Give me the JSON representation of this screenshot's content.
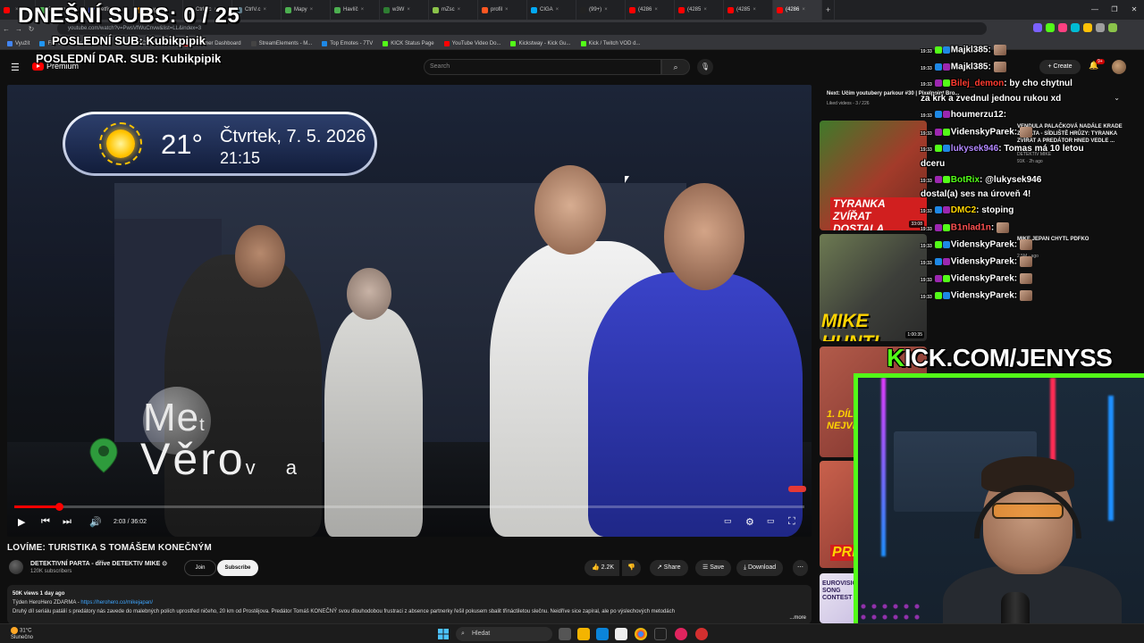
{
  "browser": {
    "tabs": [
      "",
      "2sekun",
      "Betfin",
      "网络",
      "CtrlV.c",
      "CtrlV.c",
      "Mapy",
      "Havlíč",
      "w3W",
      "mZsc",
      "profil",
      "CIGA",
      "(99+)",
      "(4286",
      "(4285",
      "(4285",
      "(4286"
    ],
    "url": "youtube.com/watch?v=PwsVfWuCnvw&list=LL&index=3",
    "bookmarks": [
      "Využít",
      "File Converter - Free...",
      "The best ChatBot an...",
      "Streamer Dashboard",
      "StreamElements - M...",
      "Top Emotes - 7TV",
      "KICK Status Page",
      "YouTube Video Do...",
      "Kickstway - Kick Gu...",
      "Kick / Twitch VOD d..."
    ]
  },
  "youtube": {
    "logo_text": "Premium",
    "search_placeholder": "Search",
    "search_icon": "search-icon",
    "mic_icon": "mic-icon",
    "create_label": "+ Create",
    "notif_count": "9+",
    "video": {
      "weather_temp": "21°",
      "weather_date": "Čtvrtek, 7. 5. 2026",
      "weather_time": "21:15",
      "loc_line1": "Me",
      "loc_line1_small": "t",
      "loc_line2": "Věro",
      "loc_line2_tail": "v a",
      "timecode": "2:03 / 36:02",
      "progress_fraction": 0.057
    },
    "title": "LOVÍME: TURISTIKA S TOMÁŠEM KONEČNÝM",
    "channel": {
      "name": "DETEKTIVNÍ PARTA - dříve DETEKTIV MIKE ⊙",
      "subscribers": "120K subscribers",
      "join_label": "Join",
      "subscribe_label": "Subscribe"
    },
    "actions": {
      "likes": "👍 2.2K",
      "dislike": "👎",
      "share": "↗ Share",
      "save": "☰ Save",
      "download": "⤓ Download",
      "more": "⋯"
    },
    "description": {
      "meta": "50K views  1 day ago",
      "line1_prefix": "Týden HeroHero ZDARMA - ",
      "line1_link": "https://herohero.co/mikejapan/",
      "line2": "Druhý díl seriálu patálií s predátory nás zavede do malebných polích uprostřed ničeho, 20 km od Prostějova. Predátor Tomáš KONEČNÝ svou dlouhodobou frustraci z absence partnerky řešil pokusem sbalit třináctiletou slečnu. Neidříve sice zapíral, ale po výslechových metodách",
      "more": "...more"
    },
    "up_next": {
      "title": "Next: Učím youtubery parkour #30 | Pixelpoint Bro...",
      "subtitle": "Liked videos - 3 / 226"
    },
    "recommendations": [
      {
        "thumb_text": "TYRANKA ZVÍŘAT DOSTALA ZÁSAH!",
        "duration": "33:08",
        "title": "VENDULA PALAČKOVÁ NADÁLE KRADE ZVÍŘATA - SÍDLIŠTĚ HRŮZY: TYRANKA ZVÍŘAT A PREDÁTOR HNED VEDLE ...",
        "channel": "DETEKTIV MIKE",
        "meta": "91K · 2h ago"
      },
      {
        "thumb_text": "MIKE HUNTI PDFKA",
        "duration": "1:00:35",
        "title": "MIKE JEPAN CHYTL PDFKO",
        "channel": "",
        "meta": "2.5M · ago"
      },
      {
        "thumb_text": "1. DÍL NEJVĚ",
        "duration": "",
        "title": "",
        "channel": "",
        "meta": ""
      },
      {
        "thumb_text": "PRE",
        "duration": "",
        "title": "",
        "channel": "",
        "meta": ""
      },
      {
        "thumb_text": "EUROVISION SONG CONTEST",
        "duration": "",
        "title": "",
        "channel": "",
        "meta": ""
      }
    ]
  },
  "overlay": {
    "subs": "DNEŠNÍ SUBS: 0 / 25",
    "last_sub": "POSLEDNÍ SUB: Kubikpipik",
    "last_donation": "POSLEDNÍ DAR. SUB: Kubikpipik",
    "kick_k": "K",
    "kick_rest": "ICK.COM/JENYSS"
  },
  "chat": [
    {
      "time": "19:33",
      "user": "Majkl385",
      "text": ":",
      "user_color": "#ffffff",
      "emote": true
    },
    {
      "time": "19:33",
      "user": "Majkl385",
      "text": ":",
      "user_color": "#ffffff",
      "emote": true
    },
    {
      "time": "19:33",
      "user": "Bilej_demon",
      "text": ": by cho chytnul",
      "user_color": "#ff3b30",
      "emote": false
    },
    {
      "time": "",
      "user": "",
      "text": "za krk a zvednul jednou rukou xd",
      "user_color": "#ffffff",
      "emote": false
    },
    {
      "time": "19:33",
      "user": "houmerzu12",
      "text": ":",
      "user_color": "#ffffff",
      "emote": false
    },
    {
      "time": "19:33",
      "user": "VidenskyParek",
      "text": ":",
      "user_color": "#ffffff",
      "emote": true
    },
    {
      "time": "19:33",
      "user": "lukysek946",
      "text": ": Tomas má 10 letou",
      "user_color": "#b388ff",
      "emote": false
    },
    {
      "time": "",
      "user": "",
      "text": "dceru",
      "user_color": "#ffffff",
      "emote": false
    },
    {
      "time": "19:33",
      "user": "BotRix",
      "text": ": @lukysek946",
      "user_color": "#53fc18",
      "emote": false
    },
    {
      "time": "",
      "user": "",
      "text": "dostal(a) ses na úroveň 4!",
      "user_color": "#ffffff",
      "emote": false
    },
    {
      "time": "19:33",
      "user": "DMC2",
      "text": ": stoping",
      "user_color": "#ffd600",
      "emote": false
    },
    {
      "time": "19:33",
      "user": "B1nlad1n",
      "text": ":",
      "user_color": "#ff5252",
      "emote": true
    },
    {
      "time": "19:33",
      "user": "VidenskyParek",
      "text": ":",
      "user_color": "#ffffff",
      "emote": true
    },
    {
      "time": "19:33",
      "user": "VidenskyParek",
      "text": ":",
      "user_color": "#ffffff",
      "emote": true
    },
    {
      "time": "19:33",
      "user": "VidenskyParek",
      "text": ":",
      "user_color": "#ffffff",
      "emote": true
    },
    {
      "time": "19:33",
      "user": "VidenskyParek",
      "text": ":",
      "user_color": "#ffffff",
      "emote": true
    }
  ],
  "taskbar": {
    "temp": "31°C",
    "condition": "Slunečno",
    "search_placeholder": "Hledat"
  },
  "colors": {
    "kick_green": "#53fc18",
    "yt_red": "#ff0000"
  }
}
